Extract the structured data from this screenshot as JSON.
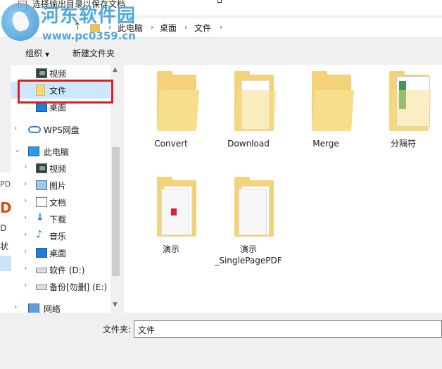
{
  "window": {
    "title": "选择输出目录以保存文档"
  },
  "watermark": {
    "brand": "河东软件园",
    "url": "www.pc0359.cn"
  },
  "address": {
    "crumbs": [
      "此电脑",
      "桌面",
      "文件"
    ]
  },
  "toolbar": {
    "organize_label": "组织",
    "new_folder_label": "新建文件夹"
  },
  "nav": {
    "items": [
      {
        "label": "视频",
        "icon": "video-icon"
      },
      {
        "label": "文件",
        "icon": "folder-icon",
        "selected": true
      },
      {
        "label": "桌面",
        "icon": "desktop-icon"
      },
      {
        "label": "WPS网盘",
        "icon": "cloud-icon"
      },
      {
        "label": "此电脑",
        "icon": "computer-icon"
      },
      {
        "label": "视频",
        "icon": "video-icon"
      },
      {
        "label": "图片",
        "icon": "pictures-icon"
      },
      {
        "label": "文档",
        "icon": "documents-icon"
      },
      {
        "label": "下载",
        "icon": "download-icon"
      },
      {
        "label": "音乐",
        "icon": "music-icon"
      },
      {
        "label": "桌面",
        "icon": "desktop-icon"
      },
      {
        "label": "软件 (D:)",
        "icon": "drive-icon"
      },
      {
        "label": "备份[勿删] (E:)",
        "icon": "drive-icon"
      },
      {
        "label": "网络",
        "icon": "network-icon"
      }
    ]
  },
  "background_app": {
    "t1": "PD",
    "t2": "D",
    "t3": "D",
    "t4": "状"
  },
  "files": [
    {
      "name": "Convert"
    },
    {
      "name": "Download"
    },
    {
      "name": "Merge"
    },
    {
      "name": "分隔符"
    },
    {
      "name": "演示"
    },
    {
      "name": "演示\n_SinglePagePDF",
      "line1": "演示",
      "line2": "_SinglePagePDF"
    }
  ],
  "footer": {
    "folder_label": "文件夹:",
    "folder_value": "文件"
  },
  "colors": {
    "selected_bg": "#cce8ff",
    "highlight": "#e01b1b",
    "folder": "#f3d27a"
  }
}
